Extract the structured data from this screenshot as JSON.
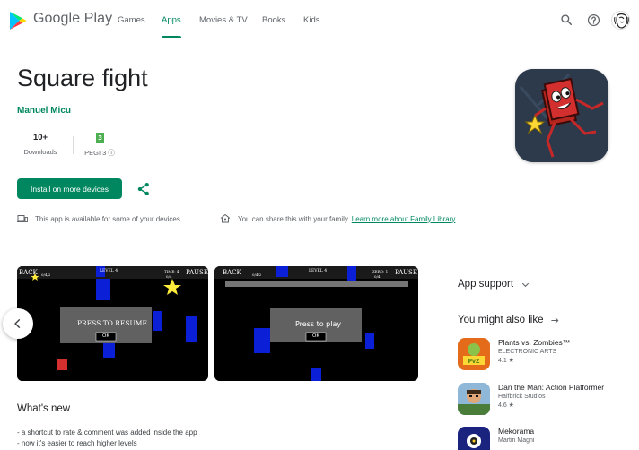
{
  "header": {
    "brand": "Google Play",
    "tabs": [
      {
        "label": "Games",
        "active": false
      },
      {
        "label": "Apps",
        "active": true
      },
      {
        "label": "Movies & TV",
        "active": false
      },
      {
        "label": "Books",
        "active": false
      },
      {
        "label": "Kids",
        "active": false
      }
    ],
    "accent_color": "#01875f"
  },
  "app": {
    "title": "Square fight",
    "developer": "Manuel Micu",
    "stats": [
      {
        "value": "10+",
        "label": "Downloads"
      },
      {
        "value": "",
        "label": "PEGI 3 ⓘ"
      }
    ],
    "install_label": "Install on more devices",
    "availability": "This app is available for some of your devices",
    "family_text": "You can share this with your family.",
    "family_link": "Learn more about Family Library"
  },
  "screenshots": [
    {
      "back": "BACK",
      "level": "LEVEL 4",
      "pause": "PAUSE",
      "score": "0/4/2",
      "time": "TIME: 4",
      "count": "0/4",
      "dialog_title": "PRESS TO RESUME",
      "dialog_button": "OK"
    },
    {
      "back": "BACK",
      "level": "LEVEL 4",
      "pause": "PAUSE",
      "score": "0/4/2",
      "time": "ZERO: 1",
      "count": "0/4",
      "dialog_title": "Press to play",
      "dialog_button": "OK"
    }
  ],
  "whats_new": {
    "title": "What's new",
    "lines": [
      "- a shortcut to rate & comment was added inside the app",
      "- now it's easier to reach higher levels"
    ]
  },
  "sidebar": {
    "support_title": "App support",
    "similar_title": "You might also like",
    "apps": [
      {
        "name": "Plants vs. Zombies™",
        "developer": "ELECTRONIC ARTS",
        "rating": "4.1 ★"
      },
      {
        "name": "Dan the Man: Action Platformer",
        "developer": "Halfbrick Studios",
        "rating": "4.6 ★"
      },
      {
        "name": "Mekorama",
        "developer": "Martin Magni",
        "rating": ""
      }
    ]
  }
}
